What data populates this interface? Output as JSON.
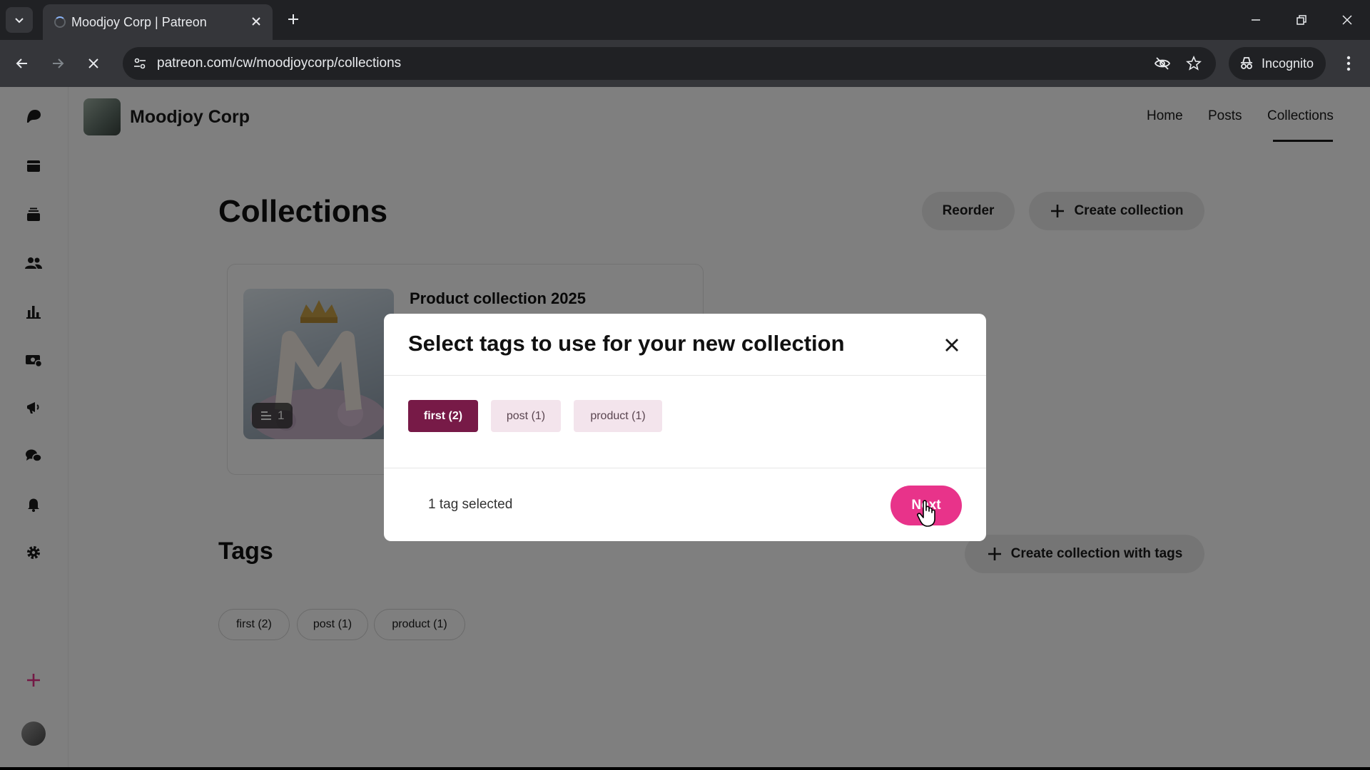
{
  "browser": {
    "tab_title": "Moodjoy Corp | Patreon",
    "url": "patreon.com/cw/moodjoycorp/collections",
    "incognito_label": "Incognito"
  },
  "creator": {
    "name": "Moodjoy Corp"
  },
  "top_nav": {
    "home": "Home",
    "posts": "Posts",
    "collections": "Collections"
  },
  "collections": {
    "heading": "Collections",
    "reorder_label": "Reorder",
    "create_label": "Create collection",
    "items": [
      {
        "title": "Product collection 2025",
        "count": "1"
      }
    ]
  },
  "tags": {
    "heading": "Tags",
    "create_with_tags_label": "Create collection with tags",
    "items": [
      "first (2)",
      "post (1)",
      "product (1)"
    ]
  },
  "modal": {
    "title": "Select tags to use for your new collection",
    "tags": [
      {
        "label": "first (2)",
        "selected": true
      },
      {
        "label": "post (1)",
        "selected": false
      },
      {
        "label": "product (1)",
        "selected": false
      }
    ],
    "status": "1 tag selected",
    "next_label": "Next"
  },
  "colors": {
    "accent": "#e8338a",
    "selected_tag": "#771a47",
    "unselected_tag": "#f3e4ec"
  }
}
